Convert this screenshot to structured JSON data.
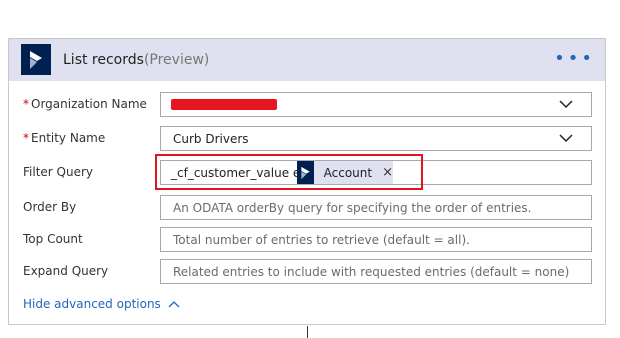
{
  "card": {
    "title": "List records",
    "title_suffix": "(Preview)",
    "more_label": "•••"
  },
  "fields": {
    "organization_name": {
      "label": "Organization Name",
      "required": true
    },
    "entity_name": {
      "label": "Entity Name",
      "required": true,
      "value": "Curb Drivers"
    },
    "filter_query": {
      "label": "Filter Query",
      "value": "_cf_customer_value eq",
      "token_label": "Account"
    },
    "order_by": {
      "label": "Order By",
      "placeholder": "An ODATA orderBy query for specifying the order of entries."
    },
    "top_count": {
      "label": "Top Count",
      "placeholder": "Total number of entries to retrieve (default = all)."
    },
    "expand_query": {
      "label": "Expand Query",
      "placeholder": "Related entries to include with requested entries (default = none)"
    }
  },
  "links": {
    "hide_advanced": "Hide advanced options"
  },
  "icons": {
    "logo": "dynamics-logo-icon",
    "dropdown": "chevron-down-icon",
    "collapse": "chevron-up-icon",
    "remove": "close-icon"
  },
  "colors": {
    "header_bg": "#dfe0f0",
    "logo_bg": "#002050",
    "link": "#2266bb",
    "highlight": "#e0141e"
  },
  "glyphs": {
    "required": "*",
    "remove": "×"
  }
}
